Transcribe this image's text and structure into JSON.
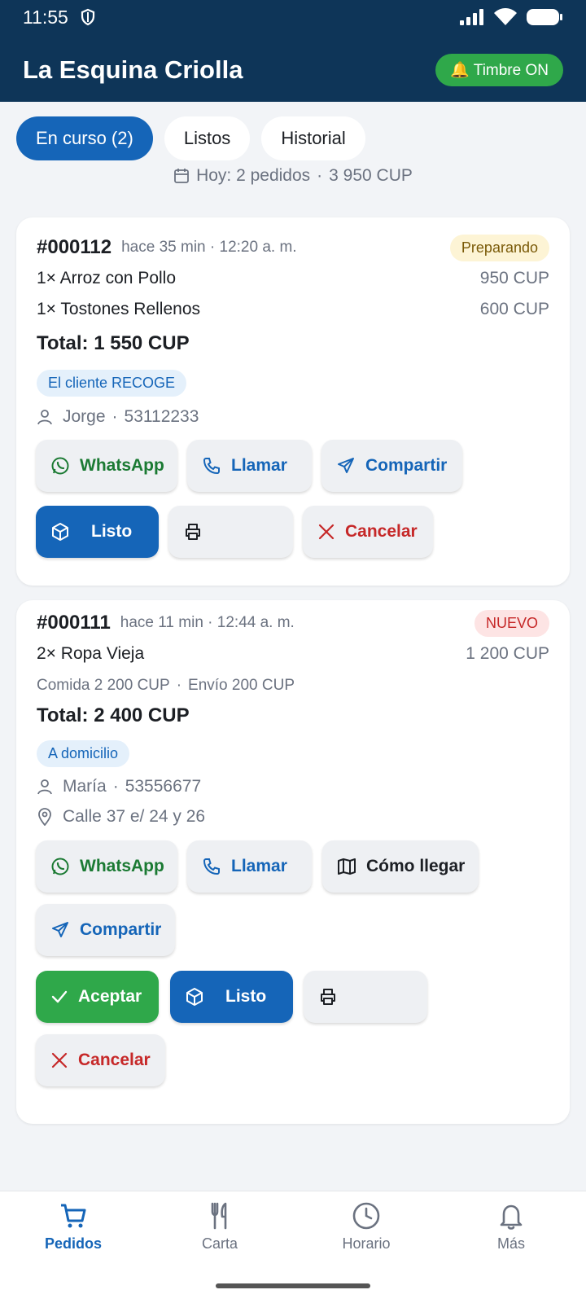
{
  "status": {
    "time": "11:55"
  },
  "appbar": {
    "title": "La Esquina Criolla",
    "bell_label": "🔔 Timbre ON"
  },
  "tabs": [
    {
      "label": "En curso (2)",
      "active": true
    },
    {
      "label": "Listos",
      "active": false
    },
    {
      "label": "Historial",
      "active": false
    }
  ],
  "summary": {
    "label": "Hoy: 2 pedidos",
    "amount": "3 950 CUP"
  },
  "orders": [
    {
      "id": "#000112",
      "meta": "hace 35 min · 12:20 a. m.",
      "status": "Preparando",
      "items": [
        {
          "name": "1× Arroz con Pollo",
          "price": "950 CUP"
        },
        {
          "name": "1× Tostones Rellenos",
          "price": "600 CUP"
        }
      ],
      "total": "Total: 1 550 CUP",
      "delivery": "El cliente RECOGE",
      "customer": "Jorge",
      "phone": "53112233",
      "buttons": {
        "whatsapp": "WhatsApp",
        "call": "Llamar",
        "share": "Compartir",
        "ready": "Listo",
        "cancel": "Cancelar"
      }
    },
    {
      "id": "#000111",
      "meta": "hace 11 min · 12:44 a. m.",
      "status": "NUEVO",
      "items": [
        {
          "name": "2× Ropa Vieja",
          "price": "1 200 CUP"
        }
      ],
      "food": "Comida 2 200 CUP",
      "shipping": "Envío 200 CUP",
      "total": "Total: 2 400 CUP",
      "delivery": "A domicilio",
      "customer": "María",
      "phone": "53556677",
      "address": "Calle 37 e/ 24 y 26",
      "buttons": {
        "whatsapp": "WhatsApp",
        "call": "Llamar",
        "directions": "Cómo llegar",
        "share": "Compartir",
        "accept": "Aceptar",
        "ready": "Listo",
        "cancel": "Cancelar"
      }
    }
  ],
  "nav": [
    {
      "label": "Pedidos",
      "active": true
    },
    {
      "label": "Carta",
      "active": false
    },
    {
      "label": "Horario",
      "active": false
    },
    {
      "label": "Más",
      "active": false
    }
  ],
  "colors": {
    "header": "#0e3558",
    "primary": "#1565b8",
    "green": "#2fa84a",
    "red": "#c62828"
  }
}
